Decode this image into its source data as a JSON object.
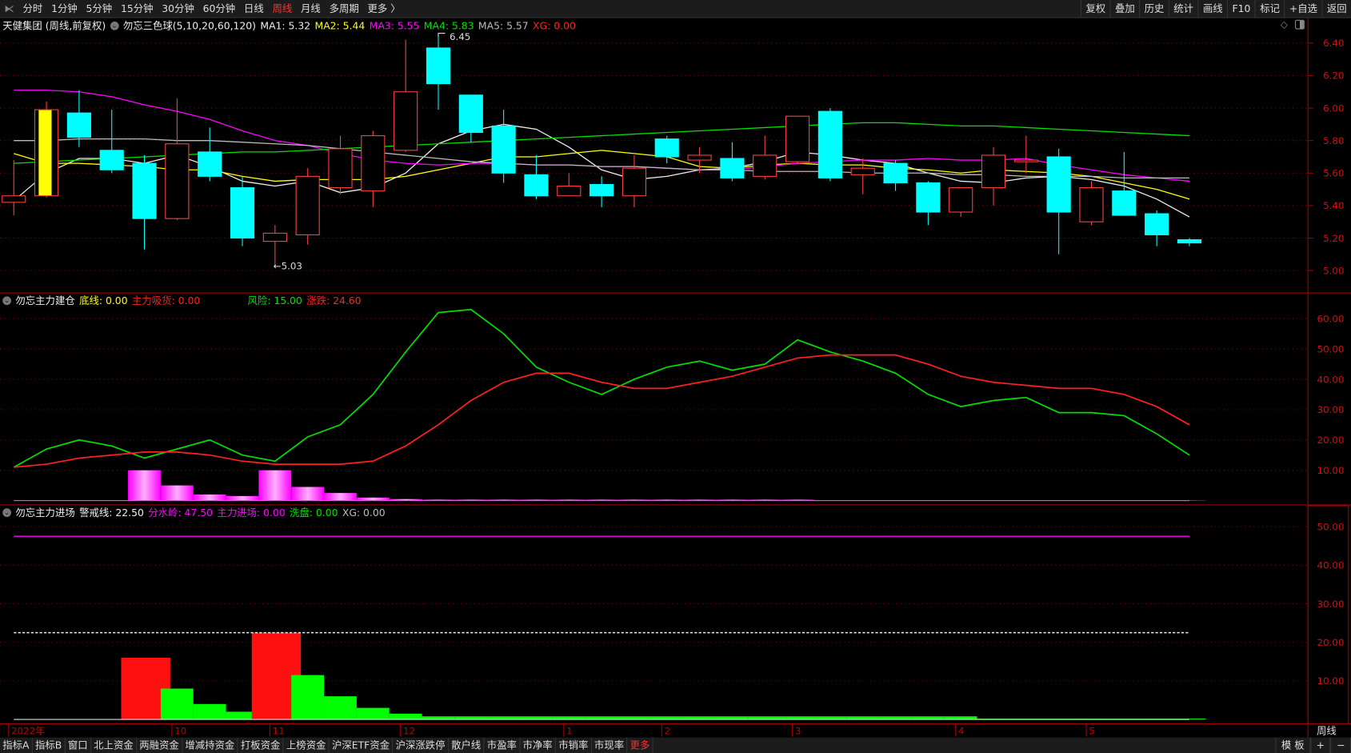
{
  "toolbar": {
    "tabs": [
      "分时",
      "1分钟",
      "5分钟",
      "15分钟",
      "30分钟",
      "60分钟",
      "日线",
      "周线",
      "月线",
      "多周期",
      "更多 〉"
    ],
    "active": "周线",
    "right_buttons": [
      "复权",
      "叠加",
      "历史",
      "统计",
      "画线",
      "F10",
      "标记",
      "+自选",
      "返回"
    ]
  },
  "main_panel": {
    "title": "天健集团 (周线,前复权)",
    "indicator": "勿忘三色球(5,10,20,60,120)",
    "legend": [
      {
        "label": "MA1: 5.32",
        "color": "#eeeeee"
      },
      {
        "label": "MA2: 5.44",
        "color": "#ffff00"
      },
      {
        "label": "MA3: 5.55",
        "color": "#ff00ff"
      },
      {
        "label": "MA4: 5.83",
        "color": "#00e000"
      },
      {
        "label": "MA5: 5.57",
        "color": "#bbbbbb"
      },
      {
        "label": "XG: 0.00",
        "color": "#ff2020"
      }
    ],
    "high_label": "6.45",
    "low_label": "←5.03",
    "axis": [
      "6.40",
      "6.20",
      "6.00",
      "5.80",
      "5.60",
      "5.40",
      "5.20",
      "5.00"
    ]
  },
  "panel2": {
    "title": "勿忘主力建仓",
    "legend": [
      {
        "label": "底线: 0.00",
        "color": "#ffff00"
      },
      {
        "label": "主力吸货: 0.00",
        "color": "#ff2020"
      },
      {
        "label": "风险: 15.00",
        "color": "#00e000"
      },
      {
        "label": "涨跌: 24.60",
        "color": "#ff2020"
      }
    ],
    "axis": [
      "60.00",
      "50.00",
      "40.00",
      "30.00",
      "20.00",
      "10.00"
    ]
  },
  "panel3": {
    "title": "勿忘主力进场",
    "legend": [
      {
        "label": "警戒线: 22.50",
        "color": "#eeeeee"
      },
      {
        "label": "分水岭: 47.50",
        "color": "#ff00ff"
      },
      {
        "label": "主力进场: 0.00",
        "color": "#ff00ff"
      },
      {
        "label": "洗盘: 0.00",
        "color": "#00e000"
      },
      {
        "label": "XG: 0.00",
        "color": "#bbbbbb"
      }
    ],
    "axis": [
      "50.00",
      "40.00",
      "30.00",
      "20.00",
      "10.00"
    ]
  },
  "date_axis": [
    {
      "label": "2022年",
      "i": 0
    },
    {
      "label": "10",
      "i": 5
    },
    {
      "label": "11",
      "i": 8
    },
    {
      "label": "12",
      "i": 12
    },
    {
      "label": "1",
      "i": 17
    },
    {
      "label": "2",
      "i": 20
    },
    {
      "label": "3",
      "i": 24
    },
    {
      "label": "4",
      "i": 29
    },
    {
      "label": "5",
      "i": 33
    }
  ],
  "period_label": "周线",
  "bottom_tabs": [
    "指标A",
    "指标B",
    "窗口",
    "北上资金",
    "两融资金",
    "增减持资金",
    "打板资金",
    "上榜资金",
    "沪深ETF资金",
    "沪深涨跌停",
    "散户线",
    "市盈率",
    "市净率",
    "市销率",
    "市现率",
    "更多"
  ],
  "bottom_right": [
    "模 板",
    "+",
    "−"
  ],
  "chart_data": [
    {
      "type": "candlestick",
      "title": "天健集团 周线",
      "ylim": [
        4.92,
        6.5
      ],
      "ohlc": [
        [
          5.42,
          5.68,
          5.34,
          5.46
        ],
        [
          5.46,
          6.04,
          5.45,
          5.99
        ],
        [
          5.97,
          6.11,
          5.76,
          5.82
        ],
        [
          5.74,
          5.99,
          5.6,
          5.62
        ],
        [
          5.66,
          5.71,
          5.13,
          5.32
        ],
        [
          5.32,
          6.06,
          5.31,
          5.78
        ],
        [
          5.73,
          5.88,
          5.55,
          5.58
        ],
        [
          5.51,
          5.58,
          5.15,
          5.2
        ],
        [
          5.18,
          5.28,
          5.03,
          5.23
        ],
        [
          5.22,
          5.63,
          5.16,
          5.58
        ],
        [
          5.51,
          5.83,
          5.47,
          5.75
        ],
        [
          5.49,
          5.86,
          5.39,
          5.83
        ],
        [
          5.74,
          6.42,
          5.73,
          6.1
        ],
        [
          6.37,
          6.45,
          5.99,
          6.15
        ],
        [
          6.08,
          6.08,
          5.79,
          5.85
        ],
        [
          5.89,
          5.99,
          5.54,
          5.6
        ],
        [
          5.59,
          5.71,
          5.44,
          5.46
        ],
        [
          5.46,
          5.6,
          5.46,
          5.52
        ],
        [
          5.53,
          5.58,
          5.39,
          5.46
        ],
        [
          5.46,
          5.71,
          5.39,
          5.63
        ],
        [
          5.81,
          5.83,
          5.66,
          5.7
        ],
        [
          5.68,
          5.76,
          5.6,
          5.71
        ],
        [
          5.69,
          5.79,
          5.55,
          5.57
        ],
        [
          5.58,
          5.83,
          5.56,
          5.71
        ],
        [
          5.67,
          5.95,
          5.66,
          5.95
        ],
        [
          5.98,
          6.0,
          5.55,
          5.57
        ],
        [
          5.59,
          5.69,
          5.47,
          5.63
        ],
        [
          5.66,
          5.68,
          5.49,
          5.54
        ],
        [
          5.54,
          5.55,
          5.28,
          5.36
        ],
        [
          5.36,
          5.51,
          5.33,
          5.51
        ],
        [
          5.51,
          5.76,
          5.4,
          5.71
        ],
        [
          5.67,
          5.83,
          5.6,
          5.68
        ],
        [
          5.7,
          5.75,
          5.1,
          5.36
        ],
        [
          5.3,
          5.55,
          5.28,
          5.51
        ],
        [
          5.49,
          5.73,
          5.34,
          5.34
        ],
        [
          5.35,
          5.37,
          5.15,
          5.22
        ],
        [
          5.19,
          5.2,
          5.15,
          5.17
        ]
      ],
      "highlight_index": 1,
      "series": [
        {
          "name": "MA1",
          "color": "#eeeeee",
          "values": [
            5.43,
            5.6,
            5.69,
            5.69,
            5.66,
            5.71,
            5.64,
            5.55,
            5.52,
            5.55,
            5.48,
            5.51,
            5.6,
            5.78,
            5.86,
            5.9,
            5.87,
            5.76,
            5.62,
            5.56,
            5.58,
            5.62,
            5.63,
            5.67,
            5.73,
            5.71,
            5.68,
            5.66,
            5.6,
            5.55,
            5.54,
            5.57,
            5.58,
            5.56,
            5.52,
            5.44,
            5.33
          ]
        },
        {
          "name": "MA2",
          "color": "#ffff00",
          "values": [
            5.72,
            5.66,
            5.66,
            5.65,
            5.64,
            5.62,
            5.62,
            5.58,
            5.55,
            5.56,
            5.56,
            5.56,
            5.58,
            5.62,
            5.66,
            5.7,
            5.7,
            5.72,
            5.74,
            5.72,
            5.7,
            5.64,
            5.63,
            5.65,
            5.66,
            5.65,
            5.65,
            5.63,
            5.62,
            5.6,
            5.62,
            5.61,
            5.6,
            5.58,
            5.54,
            5.5,
            5.44
          ]
        },
        {
          "name": "MA3",
          "color": "#ff00ff",
          "values": [
            6.11,
            6.11,
            6.1,
            6.07,
            6.02,
            5.98,
            5.93,
            5.86,
            5.8,
            5.77,
            5.72,
            5.68,
            5.66,
            5.65,
            5.66,
            5.66,
            5.65,
            5.65,
            5.64,
            5.64,
            5.63,
            5.62,
            5.62,
            5.64,
            5.66,
            5.67,
            5.68,
            5.68,
            5.69,
            5.68,
            5.68,
            5.69,
            5.65,
            5.62,
            5.59,
            5.57,
            5.55
          ]
        },
        {
          "name": "MA4",
          "color": "#00e000",
          "values": [
            5.66,
            5.67,
            5.68,
            5.69,
            5.7,
            5.71,
            5.72,
            5.73,
            5.73,
            5.74,
            5.75,
            5.76,
            5.77,
            5.78,
            5.79,
            5.8,
            5.81,
            5.82,
            5.83,
            5.84,
            5.85,
            5.86,
            5.87,
            5.88,
            5.89,
            5.9,
            5.91,
            5.91,
            5.9,
            5.89,
            5.89,
            5.88,
            5.87,
            5.86,
            5.85,
            5.84,
            5.83
          ]
        },
        {
          "name": "MA5",
          "color": "#bbbbbb",
          "values": [
            5.8,
            5.8,
            5.81,
            5.81,
            5.81,
            5.8,
            5.8,
            5.79,
            5.78,
            5.77,
            5.75,
            5.73,
            5.71,
            5.69,
            5.67,
            5.66,
            5.65,
            5.65,
            5.64,
            5.64,
            5.63,
            5.62,
            5.62,
            5.61,
            5.61,
            5.61,
            5.6,
            5.6,
            5.6,
            5.59,
            5.59,
            5.58,
            5.58,
            5.58,
            5.57,
            5.57,
            5.57
          ]
        }
      ]
    },
    {
      "type": "line",
      "title": "勿忘主力建仓",
      "ylim": [
        0,
        66
      ],
      "series": [
        {
          "name": "风险",
          "color": "#00e000",
          "values": [
            11,
            17,
            20,
            18,
            14,
            17,
            20,
            15,
            13,
            21,
            25,
            35,
            49,
            62,
            63,
            55,
            44,
            39,
            35,
            40,
            44,
            46,
            43,
            45,
            53,
            49,
            46,
            42,
            35,
            31,
            33,
            34,
            29,
            29,
            28,
            22,
            15
          ]
        },
        {
          "name": "涨跌",
          "color": "#ff2020",
          "values": [
            11,
            12,
            14,
            15,
            16,
            16,
            15,
            13,
            12,
            12,
            12,
            13,
            18,
            25,
            33,
            39,
            42,
            42,
            39,
            37,
            37,
            39,
            41,
            44,
            47,
            48,
            48,
            48,
            45,
            41,
            39,
            38,
            37,
            37,
            35,
            31,
            25
          ]
        }
      ],
      "bars": {
        "name": "主力吸货",
        "color": "#ff00ff",
        "values": [
          0,
          0,
          0,
          0,
          10,
          5,
          2,
          1.5,
          10,
          4.5,
          2.5,
          1,
          0.5,
          0.3,
          0.3,
          0.3,
          0.3,
          0.3,
          0.3,
          0.3,
          0.3,
          0.3,
          0.3,
          0.3,
          0.3,
          0.1,
          0.1,
          0.1,
          0.1,
          0.1,
          0.1,
          0.1,
          0.1,
          0.1,
          0.1,
          0.1,
          0.1
        ]
      }
    },
    {
      "type": "bar",
      "title": "勿忘主力进场",
      "ylim": [
        0,
        56
      ],
      "lines": [
        {
          "name": "分水岭",
          "value": 47.5,
          "color": "#ff00ff"
        },
        {
          "name": "警戒线",
          "value": 22.5,
          "color": "#eeeeee"
        }
      ],
      "bars": [
        {
          "v": 0,
          "c": "g"
        },
        {
          "v": 0,
          "c": "g"
        },
        {
          "v": 0,
          "c": "g"
        },
        {
          "v": 0,
          "c": "g"
        },
        {
          "v": 16,
          "c": "r"
        },
        {
          "v": 8,
          "c": "g"
        },
        {
          "v": 4,
          "c": "g"
        },
        {
          "v": 2,
          "c": "g"
        },
        {
          "v": 22.5,
          "c": "r"
        },
        {
          "v": 11.5,
          "c": "g"
        },
        {
          "v": 6,
          "c": "g"
        },
        {
          "v": 3,
          "c": "g"
        },
        {
          "v": 1.5,
          "c": "g"
        },
        {
          "v": 0.8,
          "c": "g"
        },
        {
          "v": 0.8,
          "c": "g"
        },
        {
          "v": 0.8,
          "c": "g"
        },
        {
          "v": 0.8,
          "c": "g"
        },
        {
          "v": 0.8,
          "c": "g"
        },
        {
          "v": 0.8,
          "c": "g"
        },
        {
          "v": 0.8,
          "c": "g"
        },
        {
          "v": 0.8,
          "c": "g"
        },
        {
          "v": 0.8,
          "c": "g"
        },
        {
          "v": 0.8,
          "c": "g"
        },
        {
          "v": 0.8,
          "c": "g"
        },
        {
          "v": 0.8,
          "c": "g"
        },
        {
          "v": 0.8,
          "c": "g"
        },
        {
          "v": 0.8,
          "c": "g"
        },
        {
          "v": 0.8,
          "c": "g"
        },
        {
          "v": 0.8,
          "c": "g"
        },
        {
          "v": 0.8,
          "c": "g"
        },
        {
          "v": 0.2,
          "c": "g"
        },
        {
          "v": 0.2,
          "c": "g"
        },
        {
          "v": 0.2,
          "c": "g"
        },
        {
          "v": 0.2,
          "c": "g"
        },
        {
          "v": 0.2,
          "c": "g"
        },
        {
          "v": 0.2,
          "c": "g"
        },
        {
          "v": 0.2,
          "c": "g"
        }
      ],
      "colors": {
        "r": "#ff1010",
        "g": "#00ff00"
      }
    }
  ]
}
